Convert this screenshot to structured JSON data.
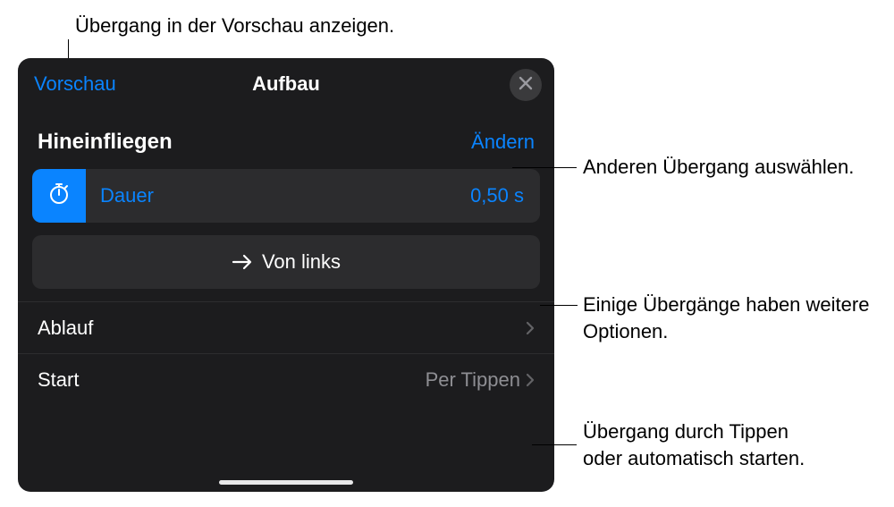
{
  "callouts": {
    "preview": "Übergang in der Vorschau anzeigen.",
    "change": "Anderen Übergang auswählen.",
    "options": "Einige Übergänge haben weitere Optionen.",
    "start_line1": "Übergang durch Tippen",
    "start_line2": "oder automatisch starten."
  },
  "header": {
    "preview_label": "Vorschau",
    "title": "Aufbau"
  },
  "effect": {
    "name": "Hineinfliegen",
    "change_label": "Ändern"
  },
  "duration": {
    "label": "Dauer",
    "value": "0,50 s"
  },
  "direction": {
    "label": "Von links"
  },
  "order_row": {
    "label": "Ablauf"
  },
  "start_row": {
    "label": "Start",
    "value": "Per Tippen"
  }
}
